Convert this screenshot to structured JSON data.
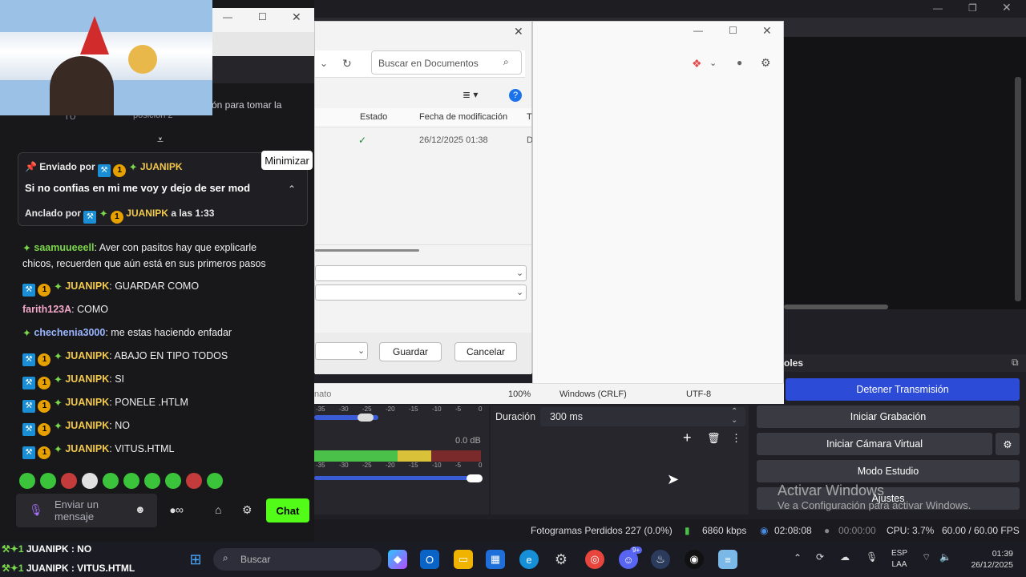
{
  "obs": {
    "controls_title": "oles",
    "buttons": [
      "Detener Transmisión",
      "Iniciar Grabación",
      "Iniciar Cámara Virtual",
      "Modo Estudio",
      "Ajustes"
    ],
    "duration_label": "Duración",
    "duration_value": "300 ms",
    "audio_db": "0.0 dB",
    "audio_scale": [
      "-35",
      "-30",
      "-25",
      "-20",
      "-15",
      "-10",
      "-5",
      "0"
    ],
    "status": {
      "dropped": "Fotogramas Perdidos 227 (0.0%)",
      "bitrate": "6860 kbps",
      "stream_time": "02:08:08",
      "rec_time": "00:00:00",
      "cpu": "CPU: 3.7%",
      "fps": "60.00 / 60.00 FPS"
    },
    "activate_title": "Activar Windows",
    "activate_sub": "Ve a Configuración para activar Windows."
  },
  "explorer": {
    "search_placeholder": "Buscar en Documentos",
    "columns": [
      "Estado",
      "Fecha de modificación",
      "T"
    ],
    "row_date": "26/12/2025 01:38",
    "row_extra": "D"
  },
  "dialog": {
    "save_label": "Guardar",
    "cancel_label": "Cancelar"
  },
  "notepad": {
    "left": "nato",
    "zoom": "100%",
    "eol": "Windows (CRLF)",
    "encoding": "UTF-8"
  },
  "tooltip": "Minimizar",
  "chat": {
    "partial_top": "ón para tomar la",
    "partial_top2": "posición 2",
    "partial_tu": "TÚ",
    "pinned": {
      "sent_by_label": "Enviado por",
      "sent_by_user": "JUANIPK",
      "text": "Si no confias en mi me voy y dejo de ser mod",
      "anchored_by_label": "Anclado por",
      "anchored_by_user": "JUANIPK",
      "anchored_time": "a las 1:33"
    },
    "messages": [
      {
        "user": "saamuueeell",
        "style": "green",
        "text": "Aver con pasitos hay que explicarle",
        "text2": "chicos, recuerden que aún está en sus primeros pasos"
      },
      {
        "user": "JUANIPK",
        "style": "gold",
        "text": "GUARDAR COMO"
      },
      {
        "user": "farith123A",
        "style": "pink",
        "text": "COMO"
      },
      {
        "user": "chechenia3000",
        "style": "blue",
        "text": "me estas haciendo enfadar"
      },
      {
        "user": "JUANIPK",
        "style": "gold",
        "text": "ABAJO EN TIPO TODOS"
      },
      {
        "user": "JUANIPK",
        "style": "gold",
        "text": "SI"
      },
      {
        "user": "JUANIPK",
        "style": "gold",
        "text": "PONELE .HTLM"
      },
      {
        "user": "JUANIPK",
        "style": "gold",
        "text": "NO"
      },
      {
        "user": "JUANIPK",
        "style": "gold",
        "text": "VITUS.HTML"
      }
    ],
    "input_placeholder": "Enviar un mensaje",
    "chat_button": "Chat",
    "overlay_line1": "JUANIPK : NO",
    "overlay_line2": "JUANIPK : VITUS.HTML"
  },
  "taskbar": {
    "search_placeholder": "Buscar",
    "lang_line1": "ESP",
    "lang_line2": "LAA",
    "time": "01:39",
    "date": "26/12/2025",
    "badge": "9+"
  },
  "colors": {
    "twitch_green": "#53fc18",
    "obs_blue": "#2c4bd6",
    "juanipk_gold": "#f2c94c"
  }
}
